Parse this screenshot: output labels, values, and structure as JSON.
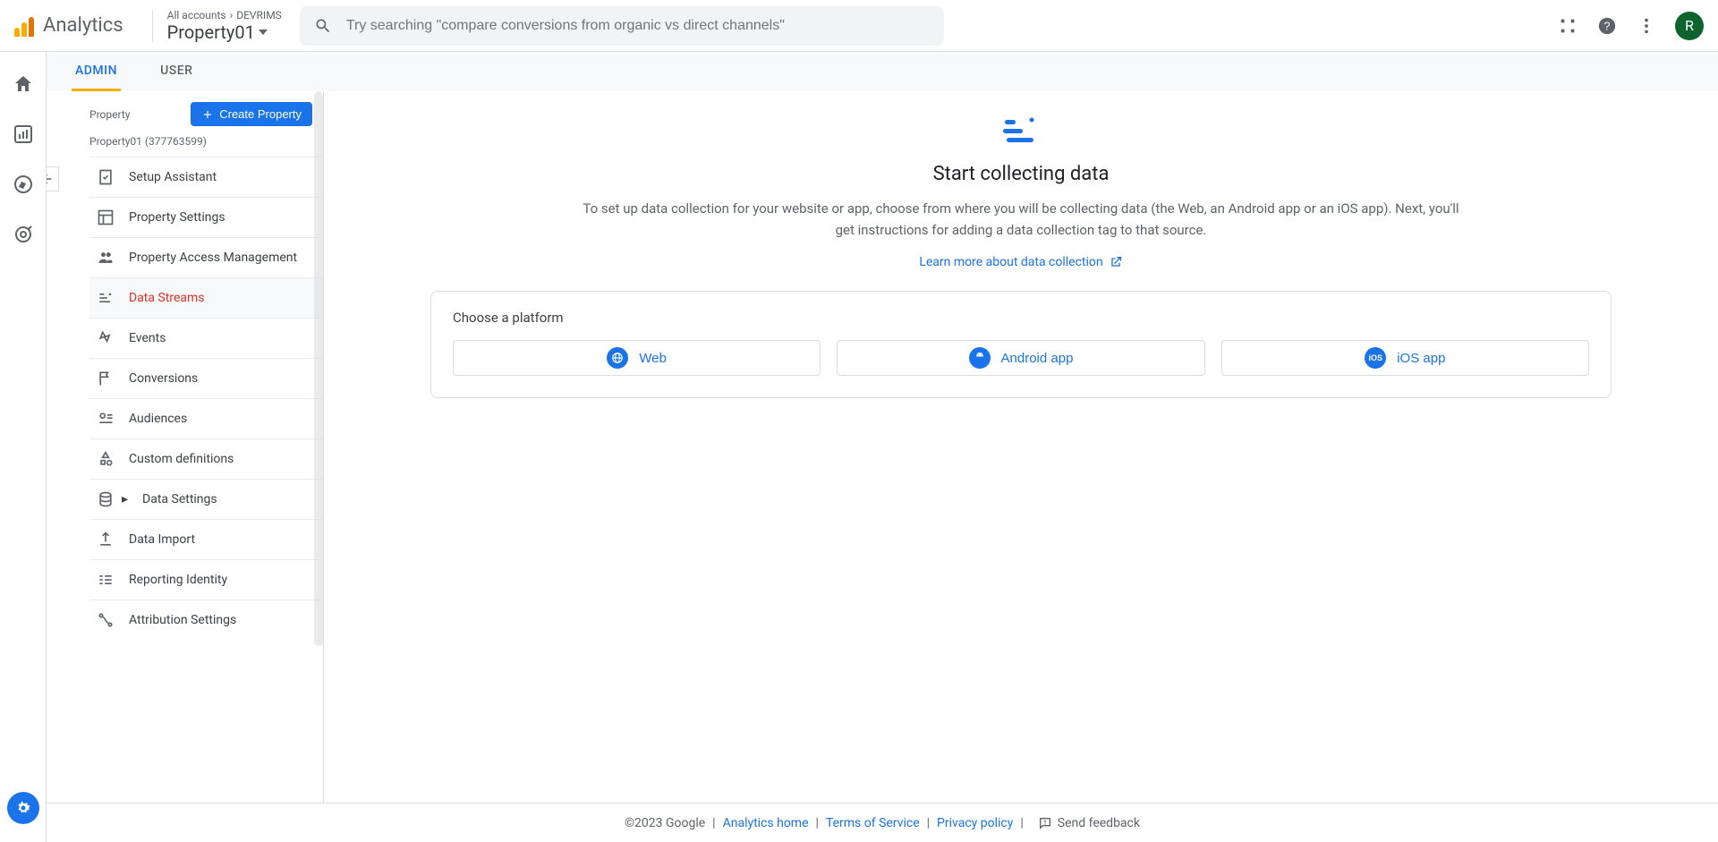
{
  "header": {
    "product": "Analytics",
    "breadcrumb_prefix": "All accounts",
    "breadcrumb_account": "DEVRIMS",
    "property_name": "Property01",
    "search_placeholder": "Try searching \"compare conversions from organic vs direct channels\"",
    "avatar_letter": "R"
  },
  "tabs": {
    "admin": "ADMIN",
    "user": "USER"
  },
  "property_column": {
    "label": "Property",
    "create_label": "Create Property",
    "property_sub": "Property01 (377763599)",
    "items": [
      {
        "label": "Setup Assistant"
      },
      {
        "label": "Property Settings"
      },
      {
        "label": "Property Access Management"
      },
      {
        "label": "Data Streams"
      },
      {
        "label": "Events"
      },
      {
        "label": "Conversions"
      },
      {
        "label": "Audiences"
      },
      {
        "label": "Custom definitions"
      },
      {
        "label": "Data Settings"
      },
      {
        "label": "Data Import"
      },
      {
        "label": "Reporting Identity"
      },
      {
        "label": "Attribution Settings"
      }
    ]
  },
  "main": {
    "title": "Start collecting data",
    "description": "To set up data collection for your website or app, choose from where you will be collecting data (the Web, an Android app or an iOS app). Next, you'll get instructions for adding a data collection tag to that source.",
    "learn_link": "Learn more about data collection",
    "platform_title": "Choose a platform",
    "platforms": {
      "web": "Web",
      "android": "Android app",
      "ios": "iOS app"
    }
  },
  "footer": {
    "copyright": "©2023 Google",
    "links": {
      "home": "Analytics home",
      "tos": "Terms of Service",
      "privacy": "Privacy policy"
    },
    "feedback": "Send feedback"
  }
}
